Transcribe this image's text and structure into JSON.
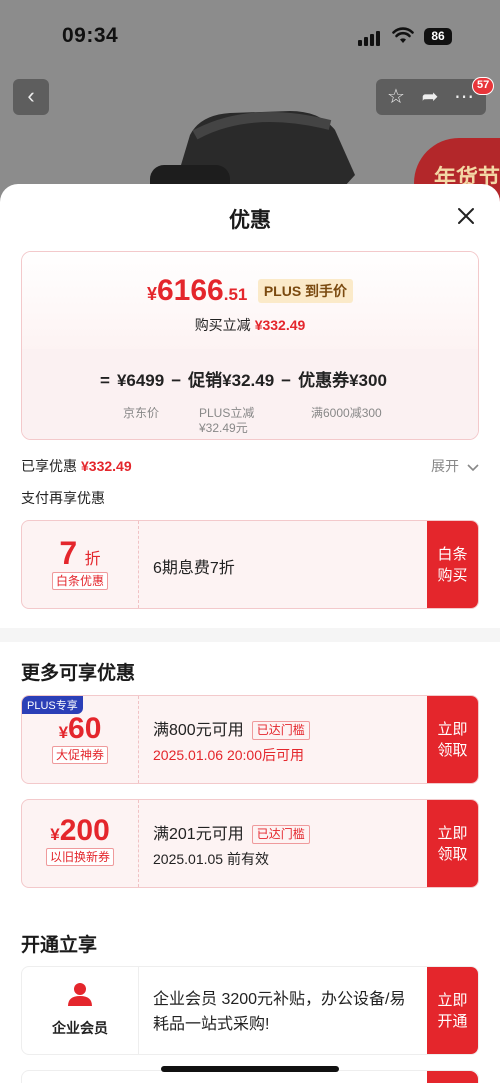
{
  "status_bar": {
    "time": "09:34",
    "battery": "86"
  },
  "nav": {
    "badge_count": "57"
  },
  "background": {
    "promo_seal": "年货节"
  },
  "sheet": {
    "title": "优惠",
    "price_card": {
      "yen": "¥",
      "price_int": "6166",
      "price_dec": ".51",
      "plus_tag": "PLUS 到手价",
      "buy_reduce_label": "购买立减",
      "buy_reduce_amount": "¥332.49",
      "formula": {
        "eq": "=",
        "jd_price": "¥6499",
        "minus1": "−",
        "promo": "促销¥32.49",
        "minus2": "−",
        "coupon": "优惠券¥300"
      },
      "jd_price_label": "京东价",
      "promo_detail_1": "PLUS立减",
      "promo_detail_2": "¥32.49元",
      "coupon_detail": "满6000减300"
    },
    "enjoyed_label": "已享优惠",
    "enjoyed_amount": "¥332.49",
    "expand_label": "展开",
    "pay_title": "支付再享优惠",
    "baitiao": {
      "discount_num": "7",
      "discount_unit": "折",
      "tag": "白条优惠",
      "desc": "6期息费7折",
      "btn_line1": "白条",
      "btn_line2": "购买"
    },
    "more_title": "更多可享优惠",
    "coupon1": {
      "corner": "PLUS专享",
      "yen": "¥",
      "amount": "60",
      "tag": "大促神券",
      "condition": "满800元可用",
      "gate": "已达门槛",
      "time": "2025.01.06 20:00后可用",
      "btn_line1": "立即",
      "btn_line2": "领取"
    },
    "coupon2": {
      "yen": "¥",
      "amount": "200",
      "tag": "以旧换新券",
      "condition": "满201元可用",
      "gate": "已达门槛",
      "time": "2025.01.05 前有效",
      "btn_line1": "立即",
      "btn_line2": "领取"
    },
    "open_title": "开通立享",
    "business": {
      "label": "企业会员",
      "desc": "企业会员 3200元补贴，办公设备/易耗品一站式采购!",
      "btn_line1": "立即",
      "btn_line2": "开通"
    }
  },
  "colors": {
    "accent": "#e4262c",
    "plus_blue": "#2b3fb7",
    "card_bg": "#fdf3f3"
  },
  "icons": [
    "back-arrow-icon",
    "star-icon",
    "share-icon",
    "more-icon",
    "close-icon",
    "chevron-down-icon",
    "person-icon"
  ]
}
